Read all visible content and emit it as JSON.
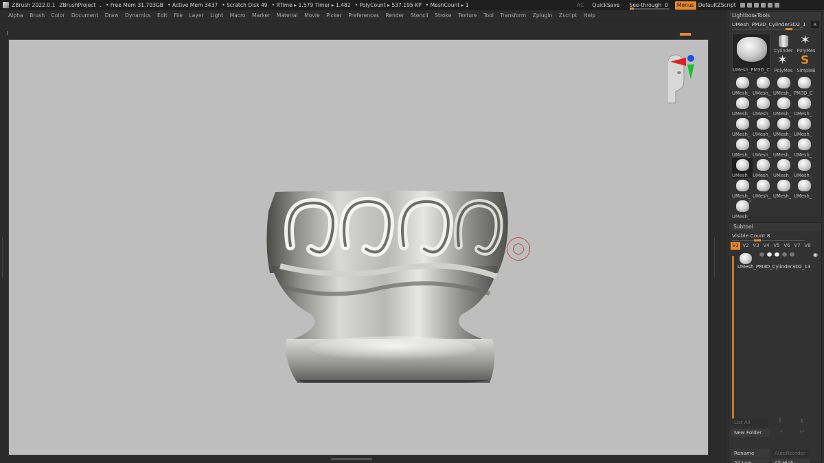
{
  "titlebar": {
    "app": "ZBrush 2022.0.1",
    "project": "ZBrushProject",
    "dot": ".",
    "free_mem": "• Free Mem 31.703GB",
    "active_mem": "• Active Mem 3437",
    "scratch": "• Scratch Disk 49",
    "timers": "• RTime ▸ 1.579 Timer ▸ 1.482",
    "polycount": "• PolyCount ▸ 537.195 KP",
    "meshcount": "• MeshCount ▸ 1",
    "ac": "AC",
    "quicksave": "QuickSave",
    "see_through_label": "See-through",
    "see_through_value": "0",
    "see_through_level": 0,
    "menus": "Menus",
    "script": "DefaultZScript"
  },
  "menubar": [
    "Alpha",
    "Brush",
    "Color",
    "Document",
    "Draw",
    "Dynamics",
    "Edit",
    "File",
    "Layer",
    "Light",
    "Macro",
    "Marker",
    "Material",
    "Movie",
    "Picker",
    "Preferences",
    "Render",
    "Stencil",
    "Stroke",
    "Texture",
    "Tool",
    "Transform",
    "Zplugin",
    "Zscript",
    "Help"
  ],
  "lightbox_tools": {
    "header": "Lightbox▸Tools",
    "current_tool": "UMesh_PM3D_Cylinder3D2_1",
    "current_tool_badge": "R",
    "big_preview_label": "UMesh_PM3D_C",
    "side_tools": [
      {
        "label": "Cylinder",
        "icon": "cylinder-icon"
      },
      {
        "label": "PolyMes",
        "icon": "star-icon"
      },
      {
        "label": "PolyMes",
        "icon": "star-icon"
      },
      {
        "label": "SimpleB",
        "icon": "simple-brush-icon"
      }
    ],
    "grid": [
      "UMesh_",
      "UMesh_",
      "UMesh_",
      "PM3D_C",
      "UMesh_",
      "UMesh_",
      "UMesh_",
      "UMesh_",
      "UMesh_",
      "UMesh_",
      "UMesh_",
      "UMesh_",
      "UMesh_",
      "UMesh_",
      "UMesh_",
      "UMesh_",
      "UMesh_",
      "UMesh_",
      "UMesh_",
      "UMesh_",
      "UMesh_",
      "UMesh_",
      "UMesh_",
      "UMesh_",
      "UMesh_"
    ],
    "last_cell_subscript": "2"
  },
  "subtool": {
    "header": "Subtool",
    "visible_count": "Visible Count 8",
    "versions": [
      "V1",
      "V2",
      "V3",
      "V4",
      "V5",
      "V6",
      "V7",
      "V8"
    ],
    "active_version": "V1",
    "item_label": "UMesh_PM3D_Cylinder3D2_13",
    "list_all": "List All",
    "new_folder": "New Folder",
    "rename": "Rename",
    "auto_reorder": "AutoReorder",
    "all_low": "All Low",
    "all_high": "All High"
  },
  "colors": {
    "accent": "#e8892b",
    "canvas_bg": "#bebebe",
    "panel_bg": "#2b2b2b"
  }
}
